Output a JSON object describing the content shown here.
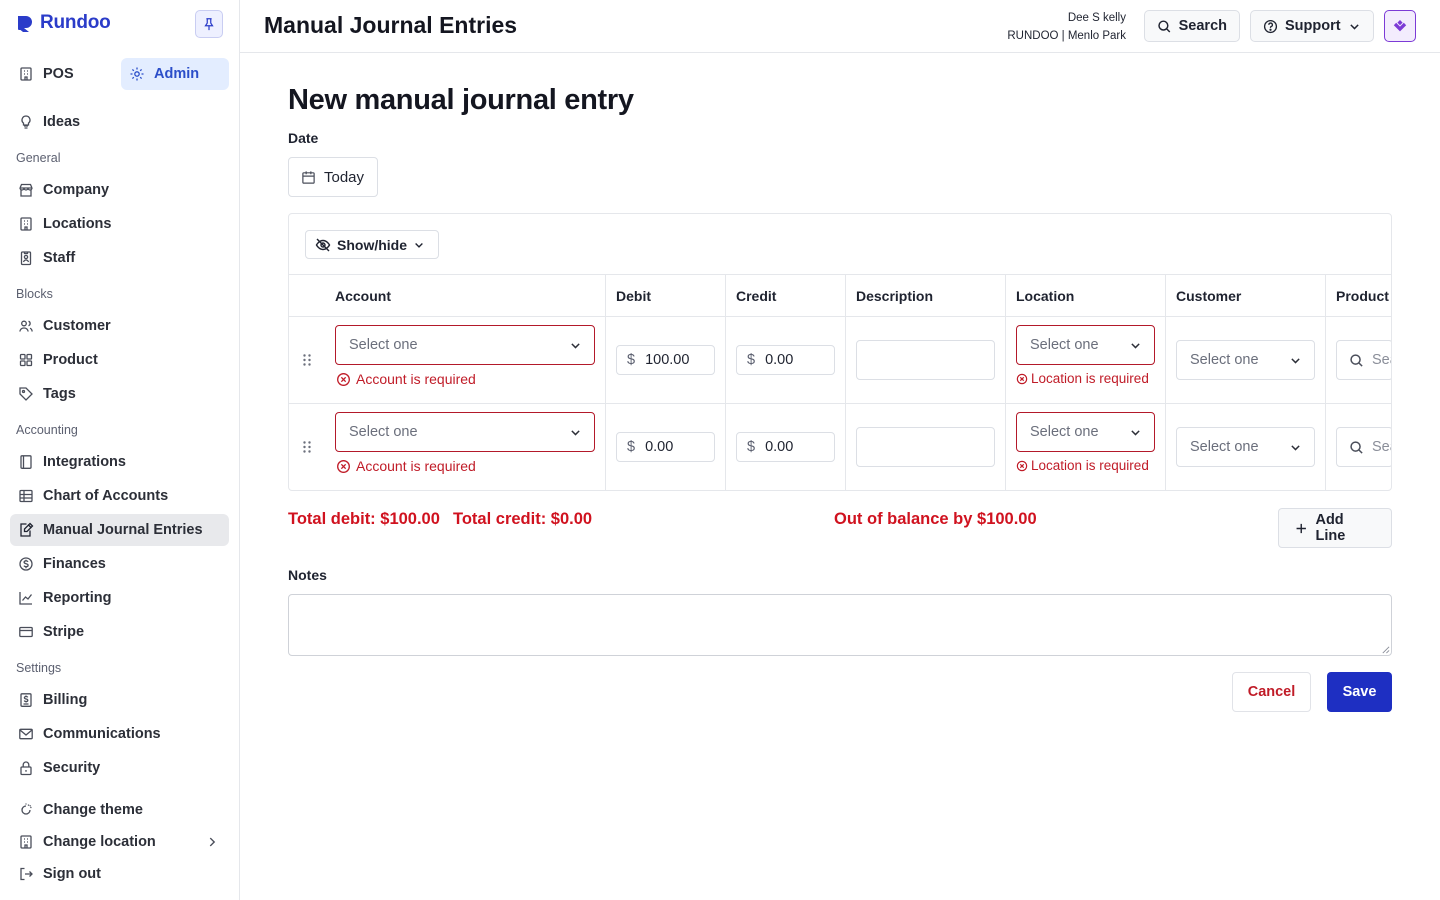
{
  "app": {
    "name": "Rundoo"
  },
  "sidebar": {
    "modes": [
      {
        "label": "POS",
        "icon": "building-icon",
        "active": false
      },
      {
        "label": "Admin",
        "icon": "gear-icon",
        "active": true
      }
    ],
    "ideas_label": "Ideas",
    "sections": {
      "general": "General",
      "blocks": "Blocks",
      "accounting": "Accounting",
      "settings": "Settings"
    },
    "items": {
      "company": "Company",
      "locations": "Locations",
      "staff": "Staff",
      "customer": "Customer",
      "product": "Product",
      "tags": "Tags",
      "integrations": "Integrations",
      "chart_of_accounts": "Chart of Accounts",
      "manual_journal_entries": "Manual Journal Entries",
      "finances": "Finances",
      "reporting": "Reporting",
      "stripe": "Stripe",
      "billing": "Billing",
      "communications": "Communications",
      "security": "Security",
      "change_theme": "Change theme",
      "change_location": "Change location",
      "sign_out": "Sign out"
    }
  },
  "header": {
    "title": "Manual Journal Entries",
    "user_name": "Dee S kelly",
    "user_org": "RUNDOO | Menlo Park",
    "search_label": "Search",
    "support_label": "Support"
  },
  "main": {
    "title": "New manual journal entry",
    "date_label": "Date",
    "date_value": "Today",
    "show_hide_label": "Show/hide",
    "columns": [
      "Account",
      "Debit",
      "Credit",
      "Description",
      "Location",
      "Customer",
      "Product"
    ],
    "rows": [
      {
        "account_placeholder": "Select one",
        "account_error": "Account is required",
        "debit_currency": "$",
        "debit": "100.00",
        "credit_currency": "$",
        "credit": "0.00",
        "description": "",
        "location_placeholder": "Select one",
        "location_error": "Location is required",
        "customer_placeholder": "Select one",
        "product_placeholder": "Search"
      },
      {
        "account_placeholder": "Select one",
        "account_error": "Account is required",
        "debit_currency": "$",
        "debit": "0.00",
        "credit_currency": "$",
        "credit": "0.00",
        "description": "",
        "location_placeholder": "Select one",
        "location_error": "Location is required",
        "customer_placeholder": "Select one",
        "product_placeholder": "Search"
      }
    ],
    "totals": {
      "debit_text": "Total debit: $100.00",
      "credit_text": "Total credit: $0.00",
      "balance_text": "Out of balance by $100.00"
    },
    "add_line_label": "Add Line",
    "notes_label": "Notes",
    "notes_value": "",
    "cancel_label": "Cancel",
    "save_label": "Save"
  },
  "colors": {
    "brand": "#2b3cc9",
    "error": "#c01c28",
    "primary_button": "#1e2fc2",
    "active_mode_bg": "#e3edff",
    "avatar_accent": "#7c3ad6"
  }
}
